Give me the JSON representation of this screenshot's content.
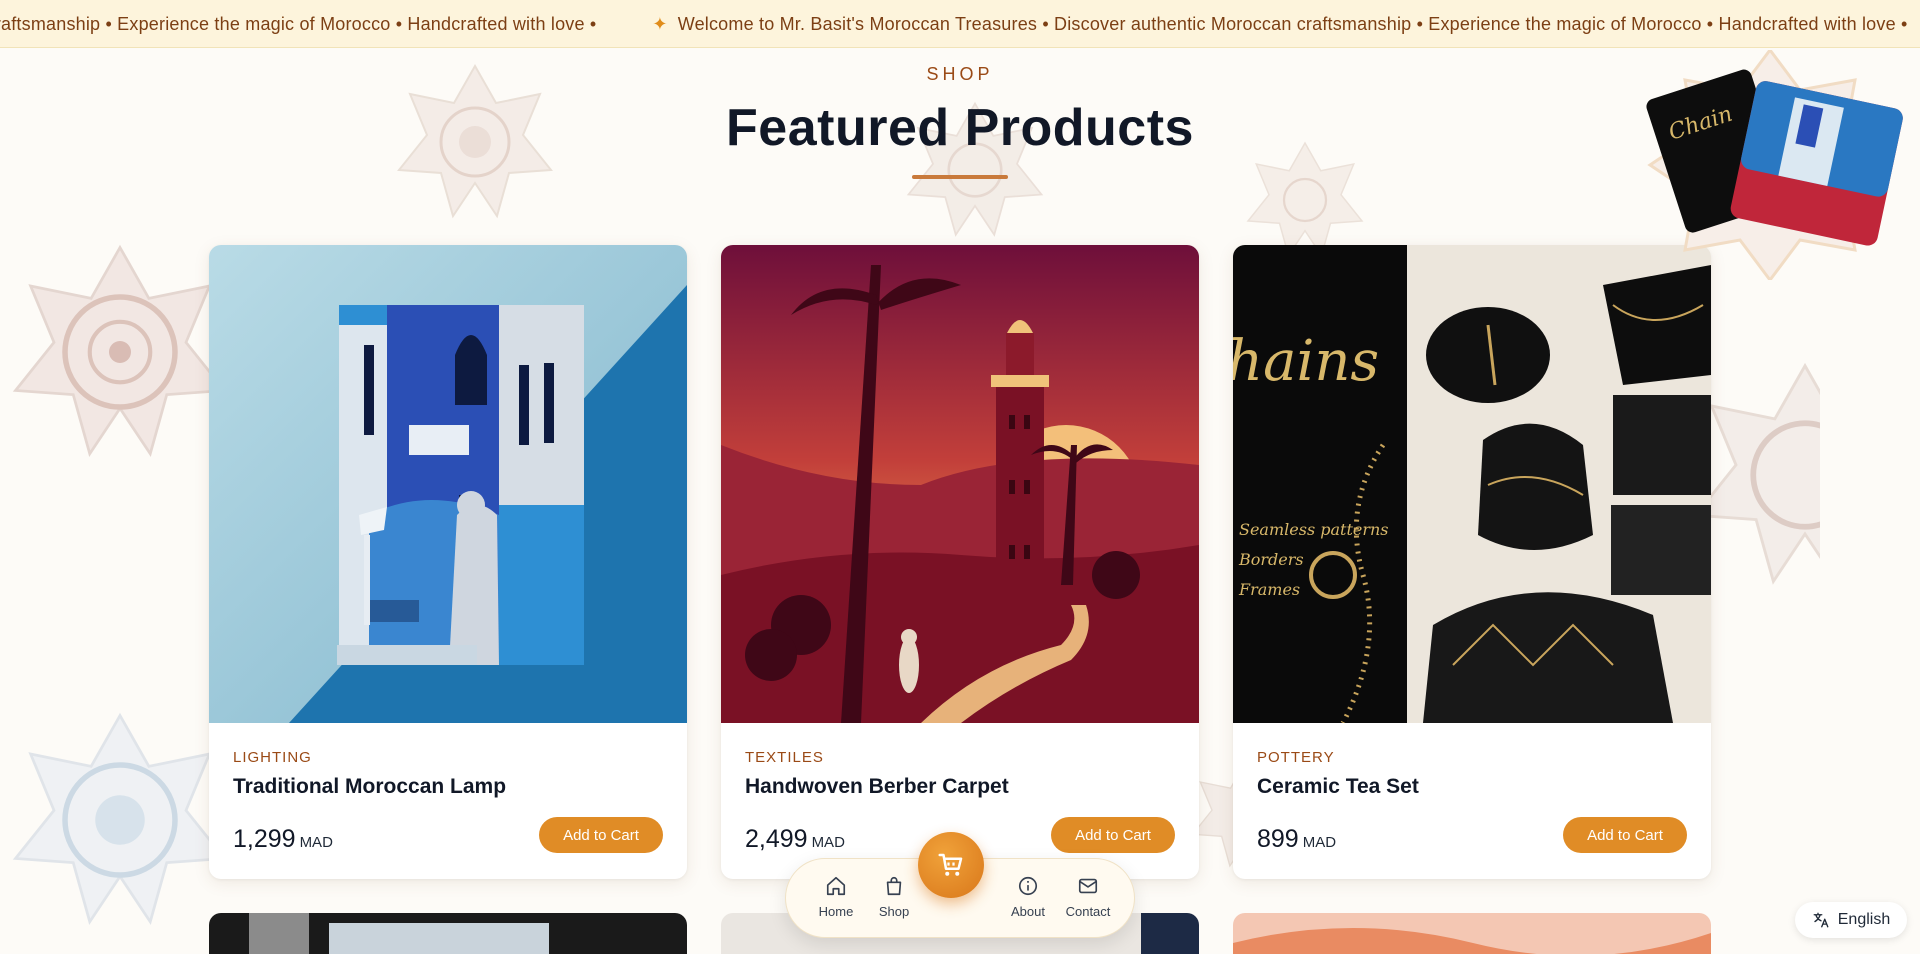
{
  "banner": {
    "segment_lead": "an craftsmanship • Experience the magic of Morocco • Handcrafted with love •",
    "segment_main": "Welcome to Mr. Basit's Moroccan Treasures • Discover authentic Moroccan craftsmanship • Experience the magic of Morocco • Handcrafted with love •"
  },
  "header": {
    "eyebrow": "SHOP",
    "title": "Featured Products"
  },
  "products": [
    {
      "category": "LIGHTING",
      "name": "Traditional Moroccan Lamp",
      "price": "1,299",
      "currency": "MAD",
      "button": "Add to Cart"
    },
    {
      "category": "TEXTILES",
      "name": "Handwoven Berber Carpet",
      "price": "2,499",
      "currency": "MAD",
      "button": "Add to Cart"
    },
    {
      "category": "POTTERY",
      "name": "Ceramic Tea Set",
      "price": "899",
      "currency": "MAD",
      "button": "Add to Cart"
    }
  ],
  "product_art": {
    "card2_script_text": "hains",
    "card2_script_lines": [
      "Seamless patterns",
      "Borders",
      "Frames"
    ]
  },
  "bottom_nav": {
    "items": [
      {
        "label": "Home",
        "icon": "home-icon"
      },
      {
        "label": "Shop",
        "icon": "shopping-bag-icon"
      },
      {
        "label": "About",
        "icon": "info-icon"
      },
      {
        "label": "Contact",
        "icon": "mail-icon"
      }
    ],
    "cart_icon": "cart-icon"
  },
  "language": {
    "label": "English",
    "icon": "translate-icon"
  },
  "colors": {
    "accent": "#e08c26",
    "brand_brown": "#9a4a16",
    "banner_bg": "#fdf4dc",
    "page_bg": "#fdfbf7"
  }
}
